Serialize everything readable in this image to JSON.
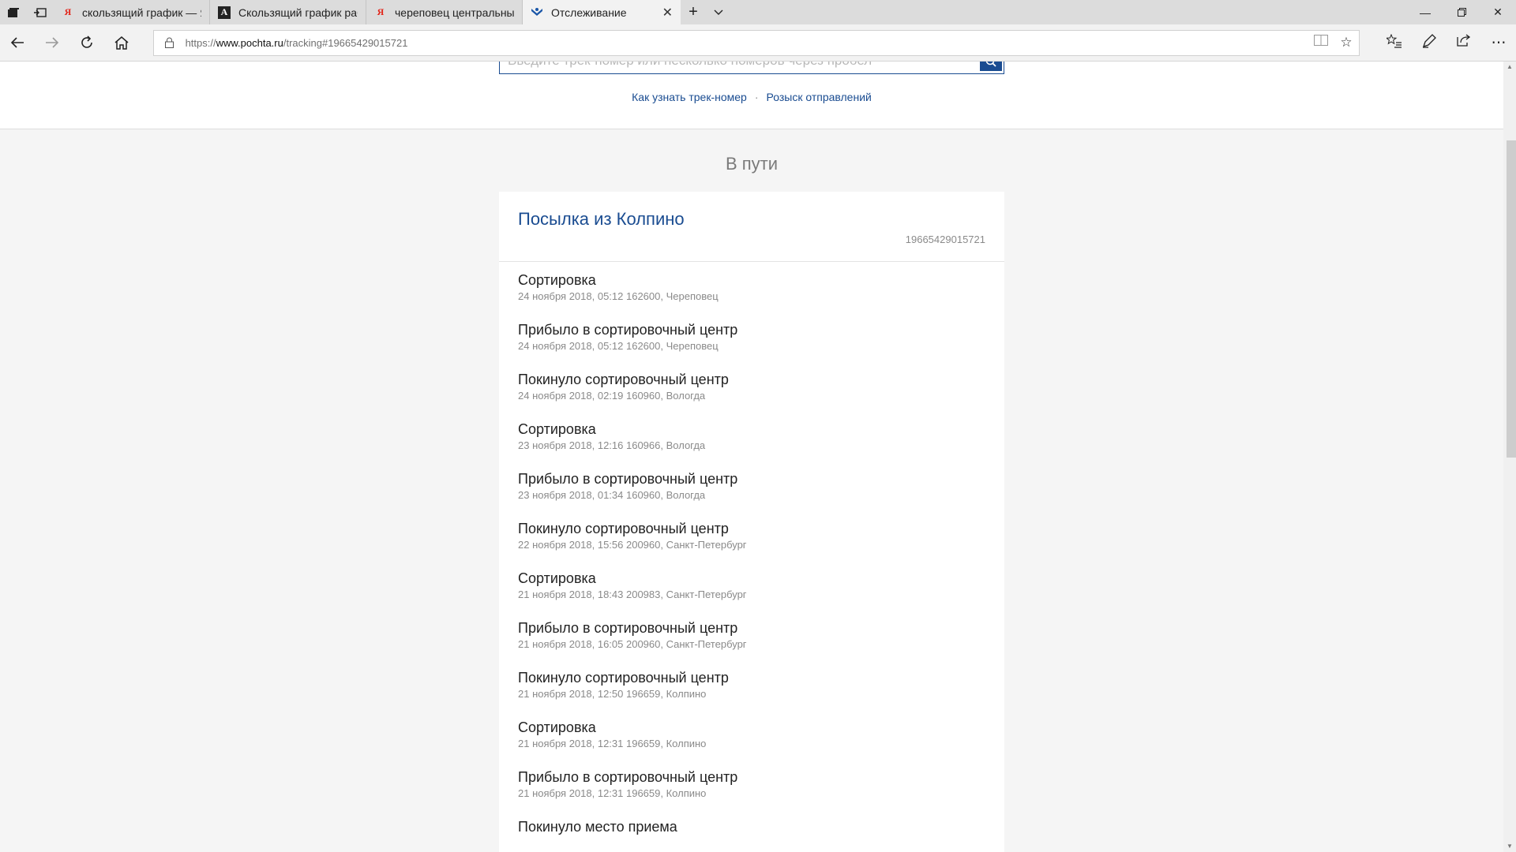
{
  "browser": {
    "tabs": [
      {
        "label": "скользящий график — Янд",
        "favicon": "yandex-icon",
        "active": false
      },
      {
        "label": "Скользящий график работ",
        "favicon": "a-letter-icon",
        "active": false
      },
      {
        "label": "череповец центральный г",
        "favicon": "yandex-icon",
        "active": false
      },
      {
        "label": "Отслеживание",
        "favicon": "pochta-icon",
        "active": true
      }
    ],
    "address": {
      "scheme": "https://",
      "host": "www.pochta.ru",
      "path": "/tracking#19665429015721"
    }
  },
  "search": {
    "placeholder": "Введите трек-номер или несколько номеров через пробел"
  },
  "help_links": [
    {
      "label": "Как узнать трек-номер"
    },
    {
      "label": "Розыск отправлений"
    }
  ],
  "status": "В пути",
  "parcel": {
    "title": "Посылка из Колпино",
    "track_number": "19665429015721"
  },
  "events": [
    {
      "title": "Сортировка",
      "meta": "24 ноября 2018, 05:12 162600, Череповец"
    },
    {
      "title": "Прибыло в сортировочный центр",
      "meta": "24 ноября 2018, 05:12 162600, Череповец"
    },
    {
      "title": "Покинуло сортировочный центр",
      "meta": "24 ноября 2018, 02:19 160960, Вологда"
    },
    {
      "title": "Сортировка",
      "meta": "23 ноября 2018, 12:16 160966, Вологда"
    },
    {
      "title": "Прибыло в сортировочный центр",
      "meta": "23 ноября 2018, 01:34 160960, Вологда"
    },
    {
      "title": "Покинуло сортировочный центр",
      "meta": "22 ноября 2018, 15:56 200960, Санкт-Петербург"
    },
    {
      "title": "Сортировка",
      "meta": "21 ноября 2018, 18:43 200983, Санкт-Петербург"
    },
    {
      "title": "Прибыло в сортировочный центр",
      "meta": "21 ноября 2018, 16:05 200960, Санкт-Петербург"
    },
    {
      "title": "Покинуло сортировочный центр",
      "meta": "21 ноября 2018, 12:50 196659, Колпино"
    },
    {
      "title": "Сортировка",
      "meta": "21 ноября 2018, 12:31 196659, Колпино"
    },
    {
      "title": "Прибыло в сортировочный центр",
      "meta": "21 ноября 2018, 12:31 196659, Колпино"
    },
    {
      "title": "Покинуло место приема",
      "meta": ""
    }
  ],
  "colors": {
    "brand": "#1a4c91",
    "muted": "#8a8a8a"
  }
}
